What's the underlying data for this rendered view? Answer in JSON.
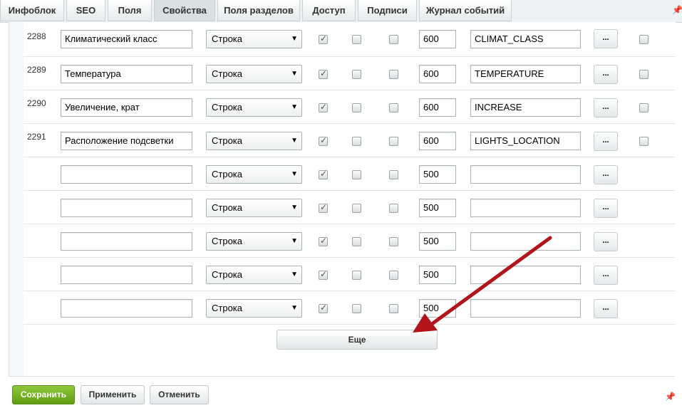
{
  "tabs": [
    {
      "label": "Инфоблок"
    },
    {
      "label": "SEO"
    },
    {
      "label": "Поля"
    },
    {
      "label": "Свойства"
    },
    {
      "label": "Поля разделов"
    },
    {
      "label": "Доступ"
    },
    {
      "label": "Подписи"
    },
    {
      "label": "Журнал событий"
    }
  ],
  "active_tab": "Свойства",
  "properties": [
    {
      "id": "2288",
      "name": "Климатический класс",
      "type": "Строка",
      "c1": true,
      "c2": false,
      "c3": false,
      "sort": "600",
      "code": "CLIMAT_CLASS",
      "more": "...",
      "del": false
    },
    {
      "id": "2289",
      "name": "Температура",
      "type": "Строка",
      "c1": true,
      "c2": false,
      "c3": false,
      "sort": "600",
      "code": "TEMPERATURE",
      "more": "...",
      "del": false
    },
    {
      "id": "2290",
      "name": "Увеличение, крат",
      "type": "Строка",
      "c1": true,
      "c2": false,
      "c3": false,
      "sort": "600",
      "code": "INCREASE",
      "more": "...",
      "del": false
    },
    {
      "id": "2291",
      "name": "Расположение подсветки",
      "type": "Строка",
      "c1": true,
      "c2": false,
      "c3": false,
      "sort": "600",
      "code": "LIGHTS_LOCATION",
      "more": "...",
      "del": false
    },
    {
      "id": "",
      "name": "",
      "type": "Строка",
      "c1": true,
      "c2": false,
      "c3": false,
      "sort": "500",
      "code": "",
      "more": "..."
    },
    {
      "id": "",
      "name": "",
      "type": "Строка",
      "c1": true,
      "c2": false,
      "c3": false,
      "sort": "500",
      "code": "",
      "more": "..."
    },
    {
      "id": "",
      "name": "",
      "type": "Строка",
      "c1": true,
      "c2": false,
      "c3": false,
      "sort": "500",
      "code": "",
      "more": "..."
    },
    {
      "id": "",
      "name": "",
      "type": "Строка",
      "c1": true,
      "c2": false,
      "c3": false,
      "sort": "500",
      "code": "",
      "more": "..."
    },
    {
      "id": "",
      "name": "",
      "type": "Строка",
      "c1": true,
      "c2": false,
      "c3": false,
      "sort": "500",
      "code": "",
      "more": "..."
    }
  ],
  "more_button": "Еще",
  "footer": {
    "save": "Сохранить",
    "apply": "Применить",
    "cancel": "Отменить"
  },
  "colors": {
    "annotation_arrow": "#b3141b",
    "save_button": "#6aa51c"
  },
  "icons": {
    "pin": "pin-icon",
    "select_arrow": "dropdown-arrow-icon"
  }
}
